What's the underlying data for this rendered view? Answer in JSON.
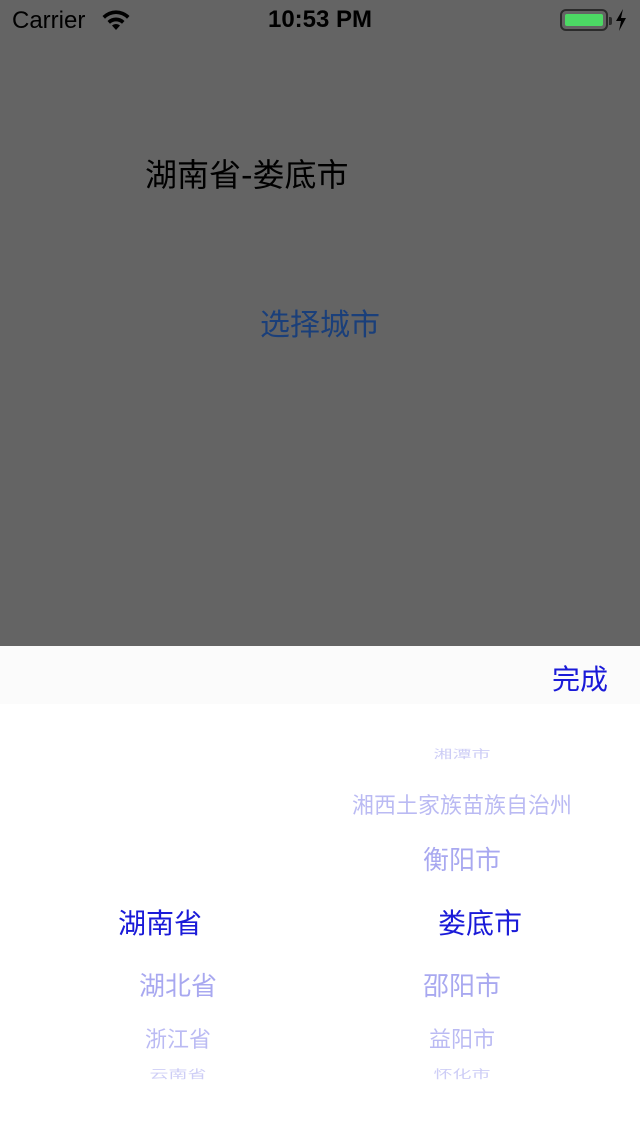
{
  "status_bar": {
    "carrier": "Carrier",
    "time": "10:53 PM",
    "battery_color": "#4cd964"
  },
  "main": {
    "selected_city": "湖南省-娄底市",
    "choose_city_label": "选择城市"
  },
  "picker": {
    "done_label": "完成",
    "provinces": {
      "selected": "湖南省",
      "below": [
        "湖北省",
        "浙江省",
        "云南省"
      ]
    },
    "cities": {
      "above": [
        "衡阳市",
        "湘西土家族苗族自治州",
        "湘潭市"
      ],
      "selected": "娄底市",
      "below": [
        "邵阳市",
        "益阳市",
        "怀化市"
      ]
    },
    "accent_color": "#1a1ad8"
  }
}
